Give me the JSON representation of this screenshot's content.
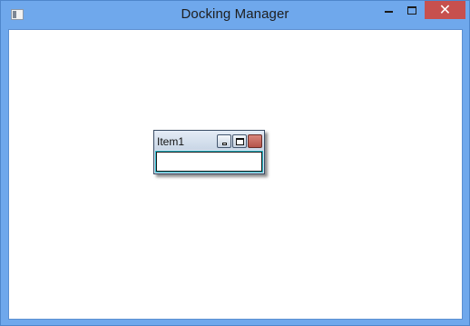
{
  "window": {
    "title": "Docking Manager",
    "icons": {
      "app": "app-window-icon",
      "minimize": "minimize-icon",
      "maximize": "maximize-icon",
      "close": "close-icon"
    },
    "close_symbol": "✕"
  },
  "floating_pane": {
    "title": "Item1",
    "icons": {
      "minimize": "minimize-icon",
      "maximize": "maximize-icon",
      "close": "close-icon"
    }
  },
  "colors": {
    "frame": "#6fa8ec",
    "close_button": "#c7504e",
    "pane_accent": "#29b8c8"
  }
}
